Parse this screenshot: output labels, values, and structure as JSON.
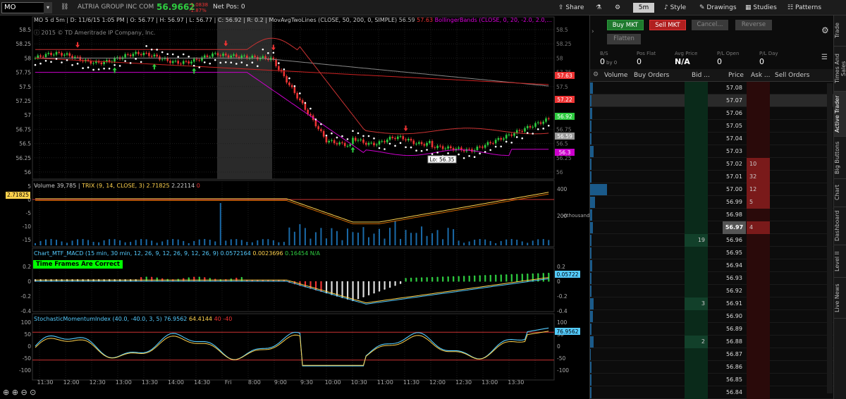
{
  "toolbar": {
    "symbol": "MO",
    "company": "ALTRIA GROUP INC COM",
    "last_price": "56.9662",
    "change": "-1.0838",
    "change_pct": "-1.87%",
    "net_pos": "Net Pos: 0",
    "share": "Share",
    "timeframe": "5m",
    "style": "Style",
    "drawings": "Drawings",
    "studies": "Studies",
    "patterns": "Patterns"
  },
  "price_pane": {
    "info": [
      "MO 5 d 5m",
      "D: 11/6/15 1:05 PM",
      "O: 56.77",
      "H: 56.97",
      "L: 56.77",
      "C: 56.92",
      "R: 0.2"
    ],
    "ma_label": "MovAvgTwoLines (CLOSE, 50, 200, 0, SIMPLE)",
    "ma_val1": "56.59",
    "ma_val2": "57.63",
    "bb_label": "BollingerBands (CLOSE, 0, 20, -2.0, 2.0,...",
    "copyright": "2015 © TD Ameritrade IP Company, Inc.",
    "y_ticks": [
      "58.5",
      "58.25",
      "58",
      "57.75",
      "57.5",
      "57.25",
      "57",
      "56.75",
      "56.5",
      "56.25",
      "56"
    ],
    "badges": [
      {
        "text": "57.63",
        "color": "#e33"
      },
      {
        "text": "57.22",
        "color": "#e33"
      },
      {
        "text": "56.92",
        "color": "#2ecc40"
      },
      {
        "text": "56.59",
        "color": "#999"
      },
      {
        "text": "56.3",
        "color": "#c0c"
      }
    ],
    "low_label": "Lo: 56.35"
  },
  "trix_pane": {
    "volume_label": "Volume",
    "volume_val": "39,785",
    "trix_label": "TRIX (9, 14, CLOSE, 3)",
    "trix_v1": "2.71825",
    "trix_v2": "2.22114",
    "trix_v3": "0",
    "badge": "2.71825",
    "y_ticks": [
      "5",
      "0",
      "-5",
      "-10",
      "-15"
    ],
    "vol_ticks": [
      "400",
      "200"
    ],
    "vol_unit": "<thousands>"
  },
  "macd_pane": {
    "label": "Chart_MTF_MACD (15 min, 30 min, 12, 26, 9, 12, 26, 9, 12, 26, 9)",
    "v1": "0.0572164",
    "v2": "0.0023696",
    "v3": "0.16454",
    "v4": "N/A",
    "banner": "Time Frames Are Correct",
    "badge": "0.05722",
    "y_ticks": [
      "0.2",
      "0",
      "-0.2",
      "-0.4"
    ]
  },
  "smi_pane": {
    "label": "StochasticMomentumIndex (40.0, -40.0, 3, 5)",
    "v1": "76.9562",
    "v2": "64.4144",
    "v3": "40",
    "v4": "-40",
    "badge": "76.9562",
    "y_ticks": [
      "100",
      "50",
      "0",
      "-50",
      "-100"
    ]
  },
  "x_axis": [
    "11:30",
    "12:00",
    "12:30",
    "13:00",
    "13:30",
    "14:00",
    "14:30",
    "Fri",
    "8:00",
    "9:00",
    "9:30",
    "10:00",
    "10:30",
    "11:00",
    "11:30",
    "12:00",
    "12:30",
    "13:00",
    "13:30"
  ],
  "active_trader": {
    "buy_mkt": "Buy MKT",
    "sell_mkt": "Sell MKT",
    "cancel": "Cancel...",
    "reverse": "Reverse",
    "flatten": "Flatten",
    "stats": [
      {
        "label": "B/S",
        "value": "0",
        "sub": "by 0"
      },
      {
        "label": "Pos Flat",
        "value": "0",
        "sub": ""
      },
      {
        "label": "Avg Price",
        "value": "N/A",
        "sub": ""
      },
      {
        "label": "P/L Open",
        "value": "0",
        "sub": ""
      },
      {
        "label": "P/L Day",
        "value": "0",
        "sub": ""
      }
    ],
    "columns": [
      "Volume",
      "Buy Orders",
      "Bid ...",
      "Price",
      "Ask ...",
      "Sell Orders"
    ],
    "ladder": [
      {
        "price": "57.08",
        "bid": "",
        "ask": "",
        "vol": 0.08
      },
      {
        "price": "57.07",
        "bid": "",
        "ask": "",
        "vol": 0.05
      },
      {
        "price": "57.06",
        "bid": "",
        "ask": "",
        "vol": 0.06
      },
      {
        "price": "57.05",
        "bid": "",
        "ask": "",
        "vol": 0.04
      },
      {
        "price": "57.04",
        "bid": "",
        "ask": "",
        "vol": 0.05
      },
      {
        "price": "57.03",
        "bid": "",
        "ask": "",
        "vol": 0.1
      },
      {
        "price": "57.02",
        "bid": "",
        "ask": "10",
        "vol": 0.04
      },
      {
        "price": "57.01",
        "bid": "",
        "ask": "32",
        "vol": 0.05
      },
      {
        "price": "57.00",
        "bid": "",
        "ask": "12",
        "vol": 0.5
      },
      {
        "price": "56.99",
        "bid": "",
        "ask": "5",
        "vol": 0.15
      },
      {
        "price": "56.98",
        "bid": "",
        "ask": "",
        "vol": 0.06
      },
      {
        "price": "56.97",
        "bid": "",
        "ask": "4",
        "vol": 0.08
      },
      {
        "price": "56.96",
        "bid": "19",
        "ask": "",
        "vol": 0.05
      },
      {
        "price": "56.95",
        "bid": "",
        "ask": "",
        "vol": 0.04
      },
      {
        "price": "56.94",
        "bid": "",
        "ask": "",
        "vol": 0.06
      },
      {
        "price": "56.93",
        "bid": "",
        "ask": "",
        "vol": 0.05
      },
      {
        "price": "56.92",
        "bid": "",
        "ask": "",
        "vol": 0.04
      },
      {
        "price": "56.91",
        "bid": "3",
        "ask": "",
        "vol": 0.1
      },
      {
        "price": "56.90",
        "bid": "",
        "ask": "",
        "vol": 0.08
      },
      {
        "price": "56.89",
        "bid": "",
        "ask": "",
        "vol": 0.04
      },
      {
        "price": "56.88",
        "bid": "2",
        "ask": "",
        "vol": 0.1
      },
      {
        "price": "56.87",
        "bid": "",
        "ask": "",
        "vol": 0.03
      },
      {
        "price": "56.86",
        "bid": "",
        "ask": "",
        "vol": 0.04
      },
      {
        "price": "56.85",
        "bid": "",
        "ask": "",
        "vol": 0.05
      },
      {
        "price": "56.84",
        "bid": "",
        "ask": "",
        "vol": 0.04
      }
    ],
    "current_price": "56.97"
  },
  "side_tabs": [
    "Trade",
    "Times And Sales",
    "Active Trader",
    "Big Buttons",
    "Chart",
    "Dashboard",
    "Level II",
    "Live News"
  ],
  "colors": {
    "up": "#2ecc40",
    "down": "#e33",
    "bg": "#000",
    "vol_bar": "#1a6aa8"
  }
}
